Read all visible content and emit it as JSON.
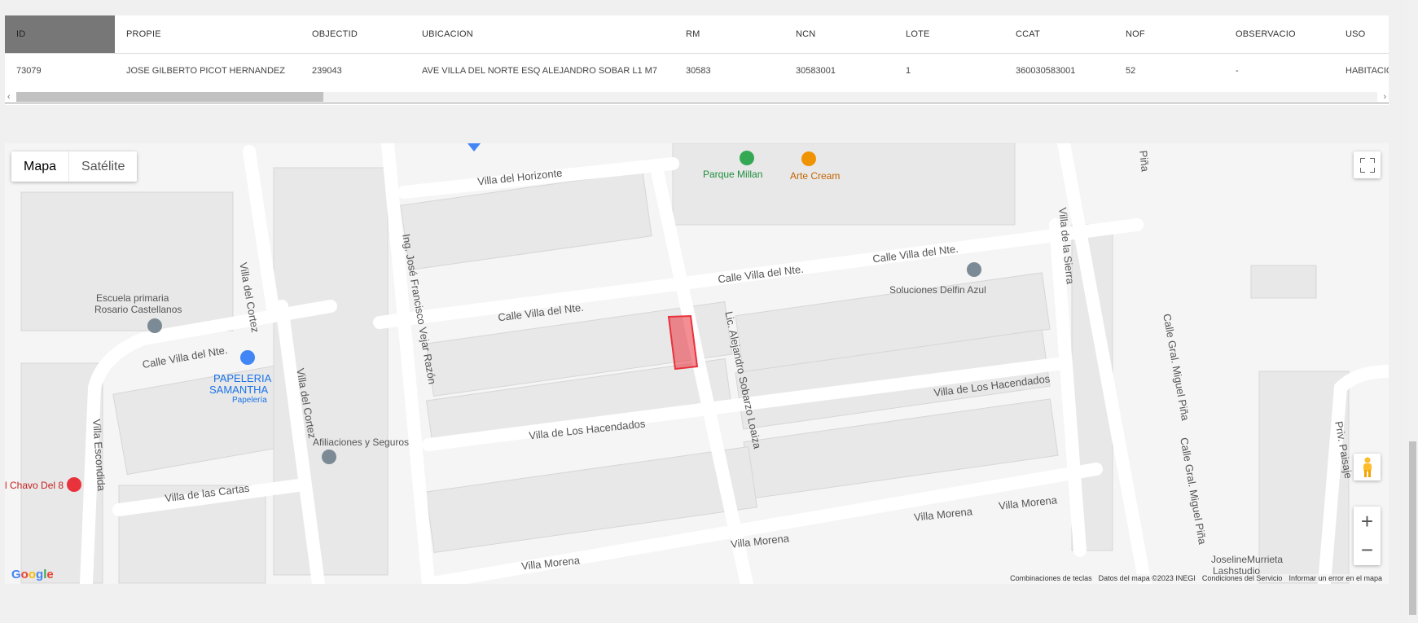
{
  "table": {
    "columns": [
      {
        "key": "ID",
        "label": "ID"
      },
      {
        "key": "PROPIE",
        "label": "PROPIE"
      },
      {
        "key": "OBJECTID",
        "label": "OBJECTID"
      },
      {
        "key": "UBICACION",
        "label": "UBICACION"
      },
      {
        "key": "RM",
        "label": "RM"
      },
      {
        "key": "NCN",
        "label": "NCN"
      },
      {
        "key": "LOTE",
        "label": "LOTE"
      },
      {
        "key": "CCAT",
        "label": "CCAT"
      },
      {
        "key": "NOF",
        "label": "NOF"
      },
      {
        "key": "OBSERVACIO",
        "label": "OBSERVACIO"
      },
      {
        "key": "USO",
        "label": "USO"
      }
    ],
    "rows": [
      {
        "ID": "73079",
        "PROPIE": "JOSE GILBERTO PICOT HERNANDEZ",
        "OBJECTID": "239043",
        "UBICACION": "AVE VILLA DEL NORTE ESQ ALEJANDRO SOBAR L1 M7",
        "RM": "30583",
        "NCN": "30583001",
        "LOTE": "1",
        "CCAT": "360030583001",
        "NOF": "52",
        "OBSERVACIO": "-",
        "USO": "HABITACIO"
      }
    ],
    "scroll_left": "‹",
    "scroll_right": "›"
  },
  "map": {
    "map_type_buttons": {
      "map": "Mapa",
      "satellite": "Satélite"
    },
    "zoom_in": "+",
    "zoom_out": "−",
    "logo": {
      "g1": "G",
      "o1": "o",
      "o2": "o",
      "g2": "g",
      "l": "l",
      "e": "e"
    },
    "attribution": {
      "shortcuts": "Combinaciones de teclas",
      "data": "Datos del mapa ©2023 INEGI",
      "terms": "Condiciones del Servicio",
      "report": "Informar un error en el mapa"
    },
    "streets": [
      "Villa del Horizonte",
      "Calle Villa del Nte.",
      "Calle Villa del Nte.",
      "Calle Villa del Nte.",
      "Calle Villa del Nte.",
      "Villa de Los Hacendados",
      "Villa de Los Hacendados",
      "Villa Morena",
      "Villa Morena",
      "Villa Morena",
      "Villa Morena",
      "Villa de las Cartas",
      "Villa del Cortez",
      "Villa del Cortez",
      "Villa Escondida",
      "Ing. José Francisco Vejar Razón",
      "Lic. Alejandro Sobarzo Loaiza",
      "Villa de la Sierra",
      "Calle Gral. Miguel Piña",
      "Calle Gral. Miguel Piña",
      "Priv. Paisaje",
      "Piña"
    ],
    "pois": {
      "park": "Parque Millan",
      "cream": "Arte Cream",
      "delfin": "Soluciones Delfin Azul",
      "school1": "Escuela primaria",
      "school2": "Rosario Castellanos",
      "papeleria1": "PAPELERIA",
      "papeleria2": "SAMANTHA",
      "papeleria3": "Papelería",
      "afiliaciones": "Afiliaciones y Seguros",
      "chavo": "l Chavo Del 8",
      "joseline1": "JoselineMurrieta",
      "joseline2": "Lashstudio"
    },
    "colors": {
      "highlight": "#e8323c",
      "road": "#ffffff",
      "block": "#e6e6e6",
      "park": "#34a853",
      "food": "#f09300"
    }
  }
}
